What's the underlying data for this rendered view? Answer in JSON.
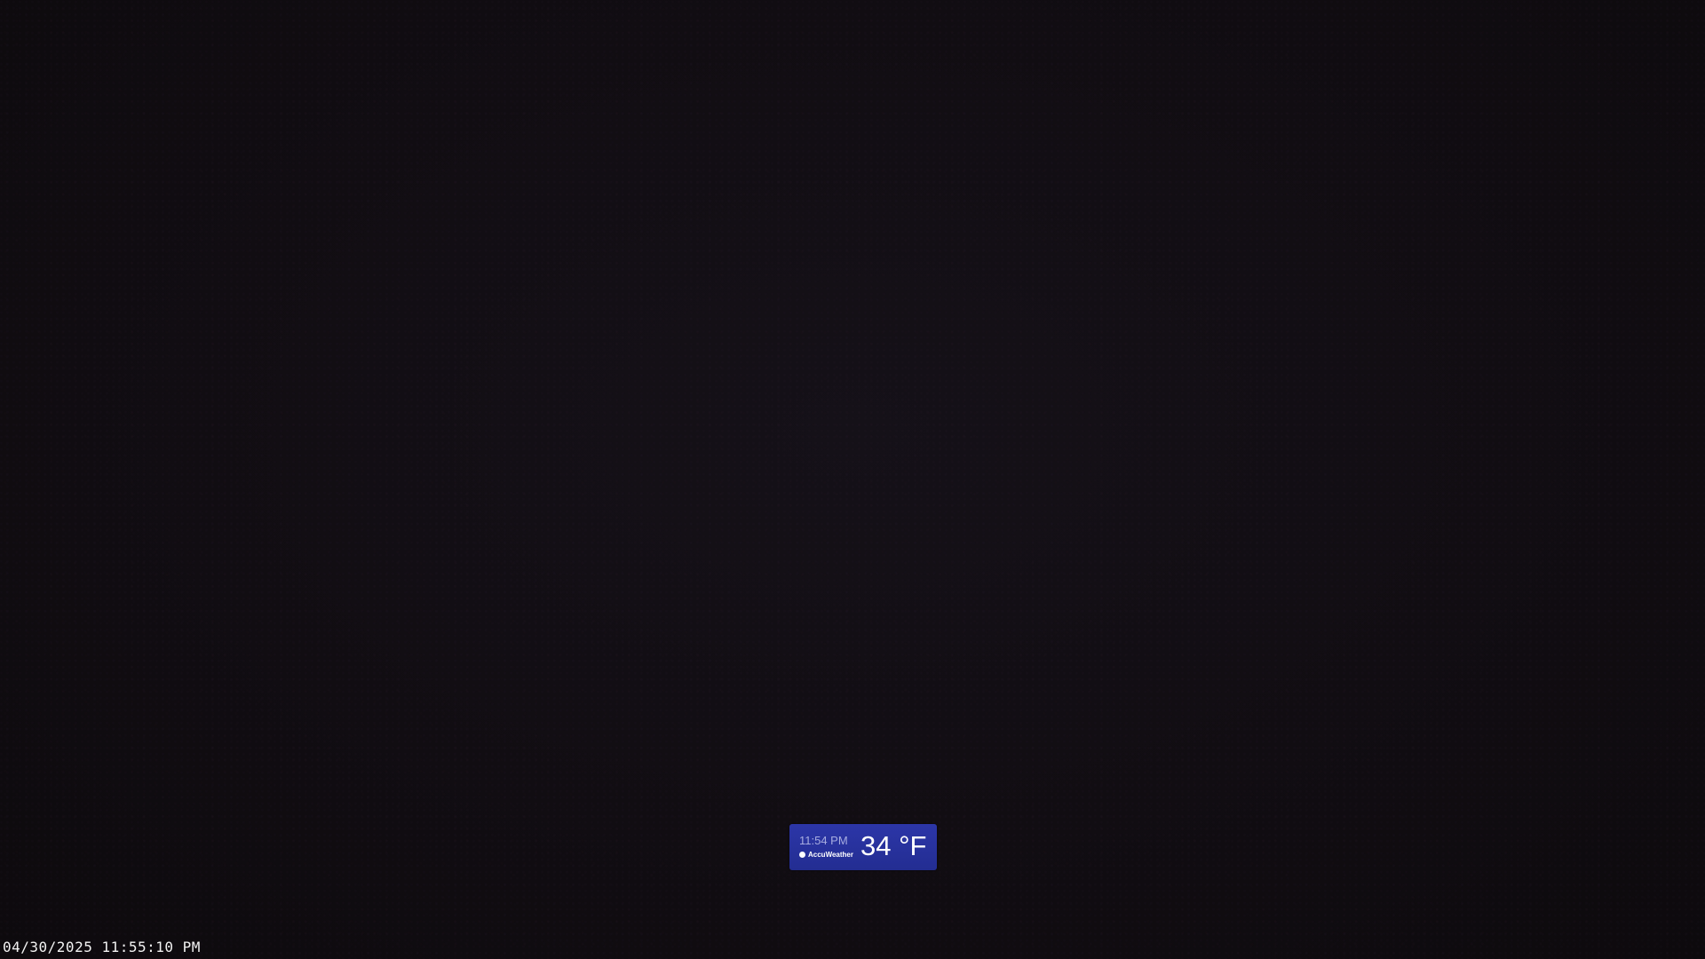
{
  "camera": {
    "timestamp": "04/30/2025 11:55:10 PM"
  },
  "weather_widget": {
    "time": "11:54 PM",
    "brand": "AccuWeather",
    "temperature": "34 °F",
    "background_color": "#2c36a8"
  }
}
